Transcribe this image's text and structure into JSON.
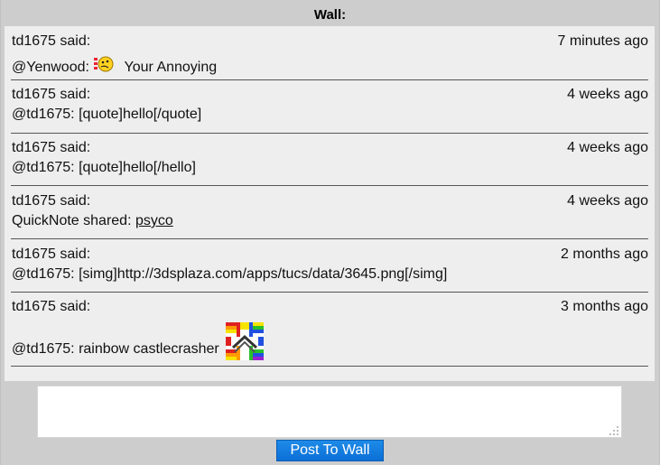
{
  "wall": {
    "title": "Wall:"
  },
  "posts": [
    {
      "author": "td1675 said:",
      "ago": "7 minutes ago",
      "prefix": "@Yenwood:",
      "text": "Your Annoying",
      "emoji": "annoyed-smiley-icon"
    },
    {
      "author": "td1675 said:",
      "ago": "4 weeks ago",
      "text": "@td1675: [quote]hello[/quote]"
    },
    {
      "author": "td1675 said:",
      "ago": "4 weeks ago",
      "text": "@td1675: [quote]hello[/hello]"
    },
    {
      "author": "td1675 said:",
      "ago": "4 weeks ago",
      "prefix": "QuickNote shared:",
      "link": "psyco"
    },
    {
      "author": "td1675 said:",
      "ago": "2 months ago",
      "text": "@td1675: [simg]http://3dsplaza.com/apps/tucs/data/3645.png[/simg]"
    },
    {
      "author": "td1675 said:",
      "ago": "3 months ago",
      "text": "@td1675: rainbow castlecrasher",
      "image": "rainbow-castlecrasher-image"
    }
  ],
  "composer": {
    "placeholder": "",
    "button_label": "Post To Wall"
  },
  "colors": {
    "frame": "#cdcdcd",
    "posts_bg": "#eeeeee",
    "button": "#1f8be8"
  }
}
